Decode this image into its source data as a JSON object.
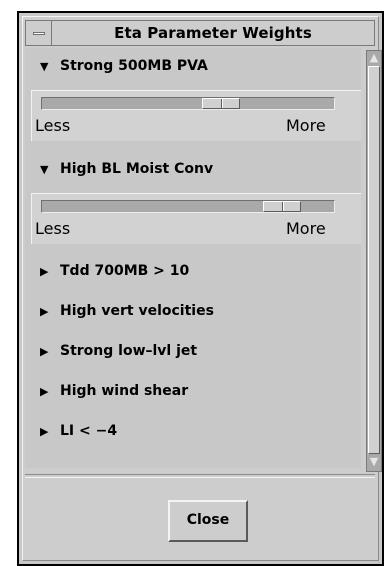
{
  "window": {
    "title": "Eta Parameter Weights"
  },
  "sections": [
    {
      "label": "Strong 500MB PVA",
      "expanded": true,
      "slider": {
        "less_label": "Less",
        "more_label": "More",
        "value_fraction": 0.63
      }
    },
    {
      "label": "High BL Moist Conv",
      "expanded": true,
      "slider": {
        "less_label": "Less",
        "more_label": "More",
        "value_fraction": 0.87
      }
    },
    {
      "label": "Tdd 700MB > 10",
      "expanded": false
    },
    {
      "label": "High vert velocities",
      "expanded": false
    },
    {
      "label": "Strong low–lvl jet",
      "expanded": false
    },
    {
      "label": "High wind shear",
      "expanded": false
    },
    {
      "label": "LI < −4",
      "expanded": false
    }
  ],
  "icons": {
    "expanded": "triangle-down-icon",
    "collapsed": "triangle-right-icon",
    "window_menu": "window-menu-icon",
    "scroll_up": "scroll-up-arrow-icon",
    "scroll_down": "scroll-down-arrow-icon"
  },
  "buttons": {
    "close_label": "Close"
  },
  "colors": {
    "background": "#c8c8c8",
    "trough": "#a9a9a9"
  }
}
